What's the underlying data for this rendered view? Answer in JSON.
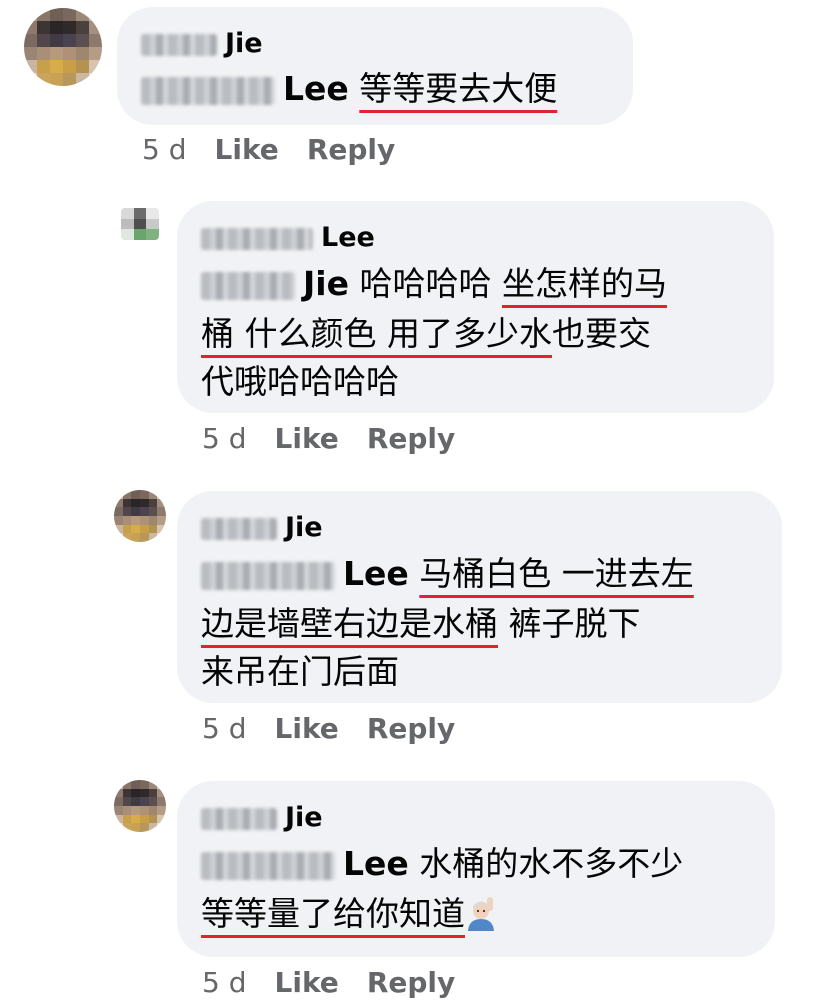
{
  "comments": [
    {
      "author_visible": "Jie",
      "mention_visible": "Lee",
      "body": "等等要去大便",
      "time": "5 d",
      "like": "Like",
      "reply": "Reply"
    },
    {
      "author_visible": "Lee",
      "mention_visible": "Jie",
      "line1": "哈哈哈哈 ",
      "line1_ul": "坐怎样的马",
      "line2_ul_a": "桶 什么颜色 用了多少水",
      "line2_rest": "也要交",
      "line3": "代哦哈哈哈哈",
      "time": "5 d",
      "like": "Like",
      "reply": "Reply"
    },
    {
      "author_visible": "Jie",
      "mention_visible": "Lee",
      "line1_ul": "马桶白色 一进去左",
      "line2_ul": "边是墙壁右边是水桶",
      "line2_rest": " 裤子脱下",
      "line3": "来吊在门后面",
      "time": "5 d",
      "like": "Like",
      "reply": "Reply"
    },
    {
      "author_visible": "Jie",
      "mention_visible": "Lee",
      "line1": "水桶的水不多不少",
      "line2_ul": "等等量了给你知道",
      "emoji": "person-raising-hand-icon",
      "time": "5 d",
      "like": "Like",
      "reply": "Reply"
    }
  ],
  "colors": {
    "bubble": "#f0f2f5",
    "underline": "#e0242f",
    "meta": "#65676b"
  }
}
